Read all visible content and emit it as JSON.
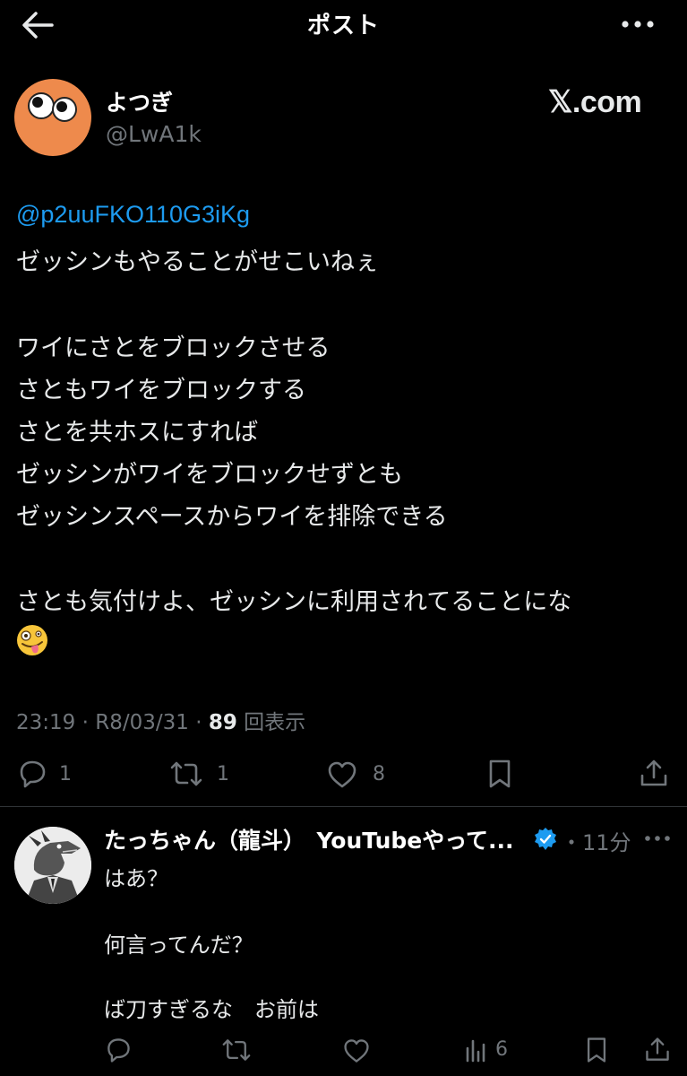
{
  "header": {
    "title": "ポスト",
    "back_icon": "arrow-left-icon",
    "more_icon": "more-horizontal-icon"
  },
  "post": {
    "display_name": "よつぎ",
    "handle": "@LwA1k",
    "watermark": "𝕏.com",
    "mention": "@p2uuFKO110G3iKg",
    "lines": [
      "ゼッシンもやることがせこいねぇ",
      "",
      "ワイにさとをブロックさせる",
      "さともワイをブロックする",
      "さとを共ホスにすれば",
      "ゼッシンがワイをブロックせずとも",
      "ゼッシンスペースからワイを排除できる",
      "",
      "さとも気付けよ、ゼッシンに利用されてることにな"
    ],
    "emoji_icon": "zany-face-emoji",
    "time": "23:19",
    "date": "R8/03/31",
    "views_count": "89",
    "views_label": "回表示",
    "actions": {
      "replies": "1",
      "reposts": "1",
      "likes": "8"
    }
  },
  "reply": {
    "display_name": "たっちゃん（龍斗）　YouTubeやって...",
    "verified_icon": "verified-badge-icon",
    "time": "・11分",
    "lines": [
      "はあ？",
      "",
      "何言ってんだ？",
      "",
      "ば刀すぎるな　お前は"
    ],
    "views": "6"
  },
  "colors": {
    "background": "#000000",
    "text": "#e7e9ea",
    "muted": "#71767b",
    "link": "#1d9bf0",
    "divider": "#2f3336",
    "avatar_orange": "#ee8a4c"
  }
}
